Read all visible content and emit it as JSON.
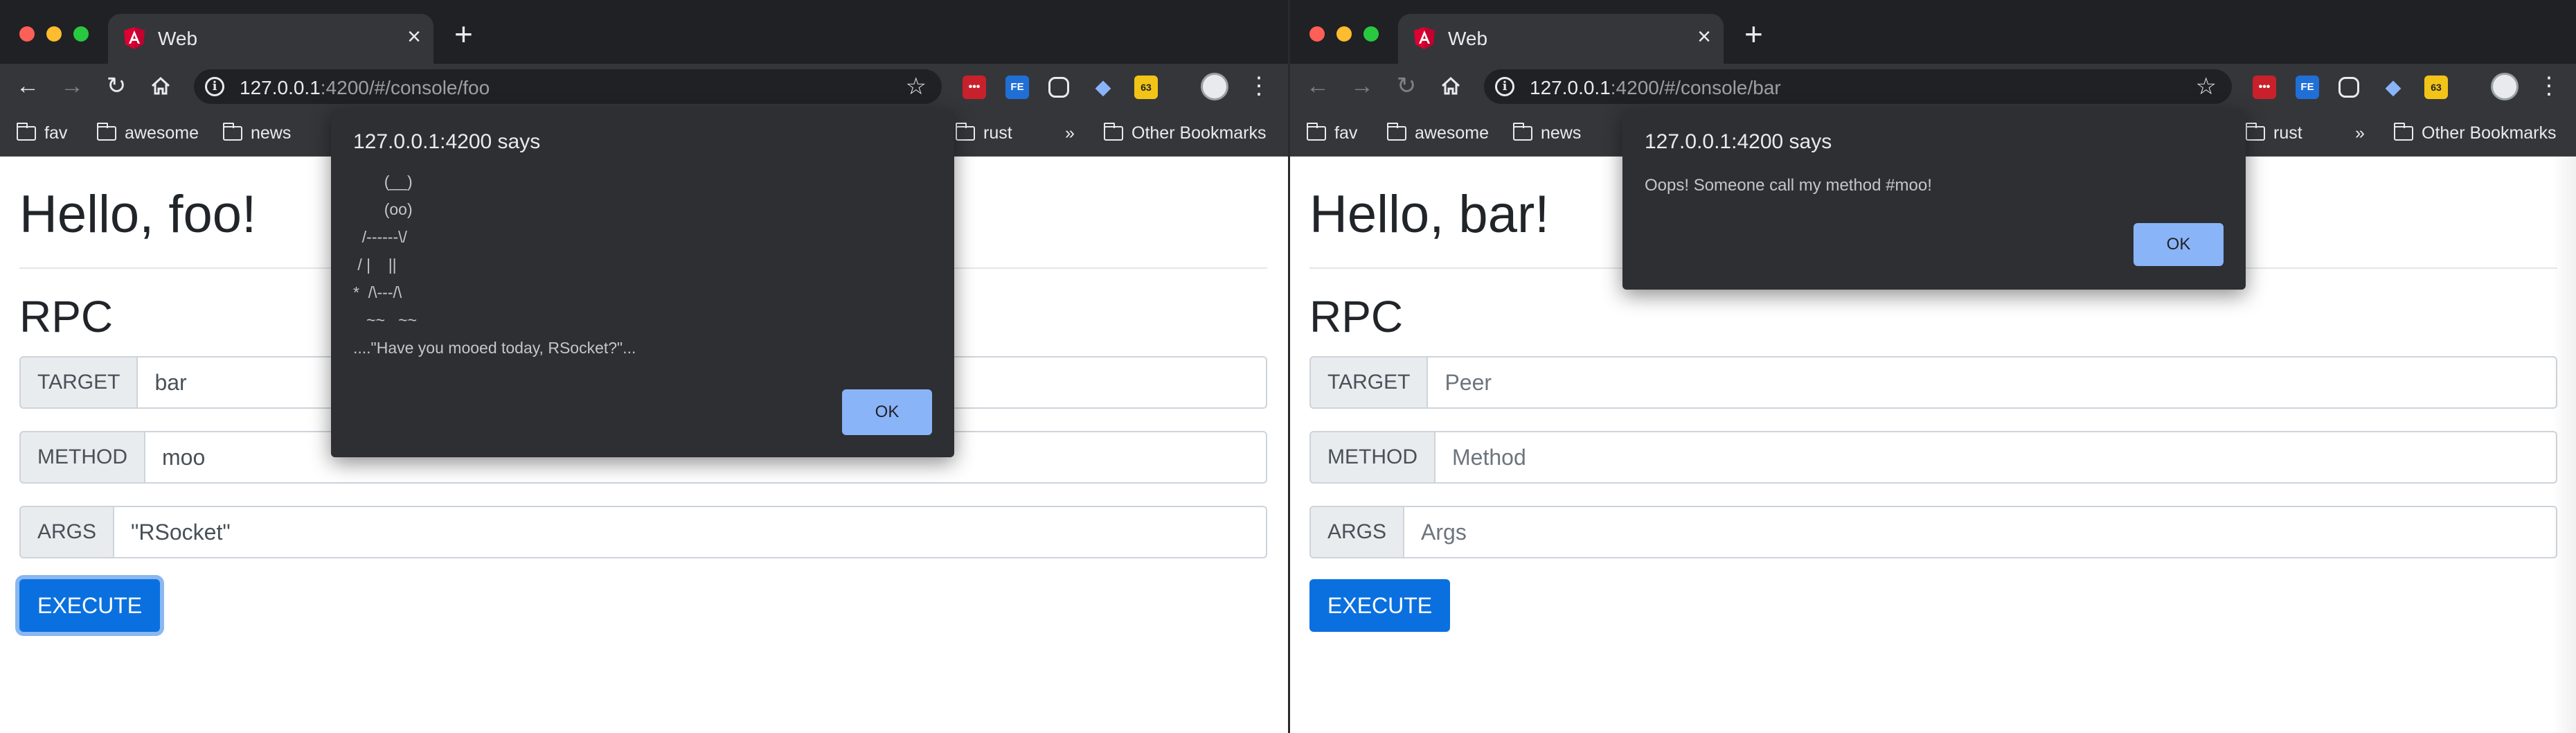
{
  "left": {
    "tab_title": "Web",
    "url_host": "127.0.0.1",
    "url_rest": ":4200/#/console/foo",
    "greeting": "Hello, foo!",
    "section_title": "RPC",
    "target_label": "TARGET",
    "target_value": "bar",
    "method_label": "METHOD",
    "method_value": "moo",
    "args_label": "ARGS",
    "args_value": "\"RSocket\"",
    "execute_label": "EXECUTE",
    "dialog": {
      "title": "127.0.0.1:4200 says",
      "ascii": "       (__)\n       (oo)\n  /------\\/\n / |    ||\n*  /\\---/\\\n   ~~   ~~\n....\"Have you mooed today, RSocket?\"...",
      "ok_label": "OK"
    }
  },
  "right": {
    "tab_title": "Web",
    "url_host": "127.0.0.1",
    "url_rest": ":4200/#/console/bar",
    "greeting": "Hello, bar!",
    "section_title": "RPC",
    "target_label": "TARGET",
    "target_placeholder": "Peer",
    "method_label": "METHOD",
    "method_placeholder": "Method",
    "args_label": "ARGS",
    "args_placeholder": "Args",
    "execute_label": "EXECUTE",
    "dialog": {
      "title": "127.0.0.1:4200 says",
      "message": "Oops! Someone call my method #moo!",
      "ok_label": "OK"
    }
  },
  "bookmarks": {
    "fav": "fav",
    "awesome": "awesome",
    "news": "news",
    "rust": "rust",
    "overflow": "»",
    "other": "Other Bookmarks"
  },
  "extensions": {
    "dots": "•••",
    "fe": "FE",
    "badge_count": "63"
  },
  "colors": {
    "primary_button": "#0a70e0",
    "dialog_bg": "#2e2f33",
    "dialog_ok": "#8ab4f8",
    "chrome_dark": "#202124"
  }
}
